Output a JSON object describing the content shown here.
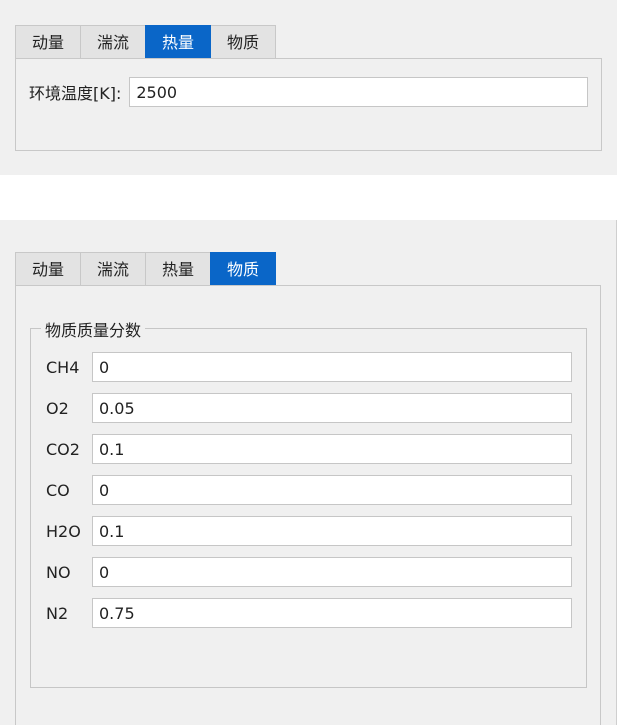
{
  "top_panel": {
    "tabs": [
      "动量",
      "湍流",
      "热量",
      "物质"
    ],
    "active_tab": 2,
    "ambient_temp_label": "环境温度[K]:",
    "ambient_temp_value": "2500"
  },
  "bottom_panel": {
    "tabs": [
      "动量",
      "湍流",
      "热量",
      "物质"
    ],
    "active_tab": 3,
    "group_title": "物质质量分数",
    "species": [
      {
        "label": "CH4",
        "value": "0"
      },
      {
        "label": "O2",
        "value": "0.05"
      },
      {
        "label": "CO2",
        "value": "0.1"
      },
      {
        "label": "CO",
        "value": "0"
      },
      {
        "label": "H2O",
        "value": "0.1"
      },
      {
        "label": "NO",
        "value": "0"
      },
      {
        "label": "N2",
        "value": "0.75"
      }
    ]
  },
  "colors": {
    "active_tab": "#0a66c8",
    "panel_bg": "#f0f0f0"
  }
}
